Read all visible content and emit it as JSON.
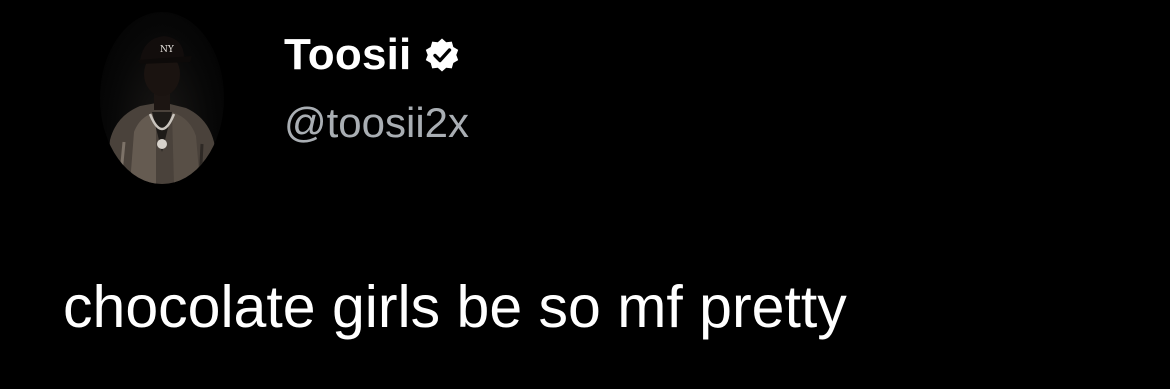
{
  "tweet": {
    "author": {
      "display_name": "Toosii",
      "handle": "@toosii2x",
      "verified": true,
      "avatar": "profile-photo"
    },
    "text": "chocolate girls be so mf pretty"
  },
  "colors": {
    "background": "#000000",
    "name": "#ffffff",
    "handle": "#a9aeb3",
    "text": "#ffffff",
    "badge_fill": "#ffffff",
    "badge_check": "#000000"
  },
  "icons": {
    "verified": "verified-badge-icon"
  }
}
